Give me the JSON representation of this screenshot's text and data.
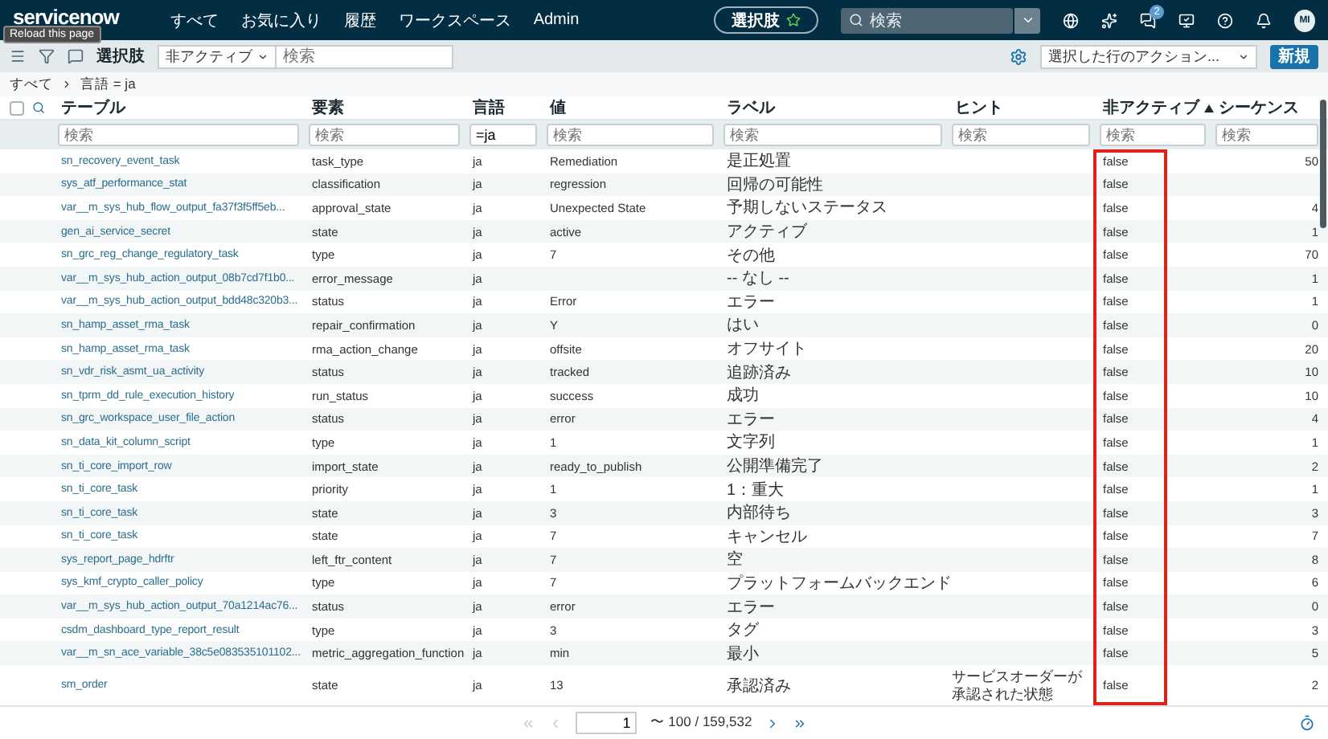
{
  "nav": {
    "logo": "servicenow",
    "items": [
      "すべて",
      "お気に入り",
      "履歴",
      "ワークスペース",
      "Admin"
    ],
    "context": "選択肢",
    "search": {
      "placeholder": "検索"
    },
    "icons": [
      {
        "kind": "globe"
      },
      {
        "kind": "sparkle"
      },
      {
        "kind": "chat",
        "badge": "2"
      },
      {
        "kind": "screen"
      },
      {
        "kind": "help"
      },
      {
        "kind": "bell"
      }
    ],
    "avatar": "MI"
  },
  "tooltip": "Reload this page",
  "toolbar": {
    "title": "選択肢",
    "field_select": "非アクティブ",
    "search": {
      "placeholder": "検索"
    },
    "actions_select": "選択した行のアクション...",
    "new_button": "新規"
  },
  "breadcrumb": [
    "すべて",
    "言語 = ja"
  ],
  "table": {
    "select_all": {
      "checked": false
    },
    "columns": [
      {
        "label": "テーブル",
        "filter": {
          "placeholder": "検索"
        }
      },
      {
        "label": "要素",
        "filter": {
          "placeholder": "検索"
        }
      },
      {
        "label": "言語",
        "filter": {
          "value": "=ja"
        }
      },
      {
        "label": "値",
        "filter": {
          "placeholder": "検索"
        }
      },
      {
        "label": "ラベル",
        "filter": {
          "placeholder": "検索"
        }
      },
      {
        "label": "ヒント",
        "filter": {
          "placeholder": "検索"
        }
      },
      {
        "label": "非アクティブ",
        "sort_ascending": true,
        "filter": {
          "placeholder": "検索"
        }
      },
      {
        "label": "シーケンス",
        "filter": {
          "placeholder": "検索"
        }
      }
    ],
    "rows": [
      {
        "table": "sn_recovery_event_task",
        "element": "task_type",
        "language": "ja",
        "value": "Remediation",
        "label": "是正処置",
        "inactive": "false",
        "sequence": "50"
      },
      {
        "table": "sys_atf_performance_stat",
        "element": "classification",
        "language": "ja",
        "value": "regression",
        "label": "回帰の可能性",
        "inactive": "false"
      },
      {
        "table": "var__m_sys_hub_flow_output_fa37f3f5ff5eb...",
        "element": "approval_state",
        "language": "ja",
        "value": "Unexpected State",
        "label": "予期しないステータス",
        "inactive": "false",
        "sequence": "4"
      },
      {
        "table": "gen_ai_service_secret",
        "element": "state",
        "language": "ja",
        "value": "active",
        "label": "アクティブ",
        "inactive": "false",
        "sequence": "1"
      },
      {
        "table": "sn_grc_reg_change_regulatory_task",
        "element": "type",
        "language": "ja",
        "value": "7",
        "label": "その他",
        "inactive": "false",
        "sequence": "70"
      },
      {
        "table": "var__m_sys_hub_action_output_08b7cd7f1b0...",
        "element": "error_message",
        "language": "ja",
        "label": "-- なし --",
        "inactive": "false",
        "sequence": "1"
      },
      {
        "table": "var__m_sys_hub_action_output_bdd48c320b3...",
        "element": "status",
        "language": "ja",
        "value": "Error",
        "label": "エラー",
        "inactive": "false",
        "sequence": "1"
      },
      {
        "table": "sn_hamp_asset_rma_task",
        "element": "repair_confirmation",
        "language": "ja",
        "value": "Y",
        "label": "はい",
        "inactive": "false",
        "sequence": "0"
      },
      {
        "table": "sn_hamp_asset_rma_task",
        "element": "rma_action_change",
        "language": "ja",
        "value": "offsite",
        "label": "オフサイト",
        "inactive": "false",
        "sequence": "20"
      },
      {
        "table": "sn_vdr_risk_asmt_ua_activity",
        "element": "status",
        "language": "ja",
        "value": "tracked",
        "label": "追跡済み",
        "inactive": "false",
        "sequence": "10"
      },
      {
        "table": "sn_tprm_dd_rule_execution_history",
        "element": "run_status",
        "language": "ja",
        "value": "success",
        "label": "成功",
        "inactive": "false",
        "sequence": "10"
      },
      {
        "table": "sn_grc_workspace_user_file_action",
        "element": "status",
        "language": "ja",
        "value": "error",
        "label": "エラー",
        "inactive": "false",
        "sequence": "4"
      },
      {
        "table": "sn_data_kit_column_script",
        "element": "type",
        "language": "ja",
        "value": "1",
        "label": "文字列",
        "inactive": "false",
        "sequence": "1"
      },
      {
        "table": "sn_ti_core_import_row",
        "element": "import_state",
        "language": "ja",
        "value": "ready_to_publish",
        "label": "公開準備完了",
        "inactive": "false",
        "sequence": "2"
      },
      {
        "table": "sn_ti_core_task",
        "element": "priority",
        "language": "ja",
        "value": "1",
        "label": "1：重大",
        "inactive": "false",
        "sequence": "1"
      },
      {
        "table": "sn_ti_core_task",
        "element": "state",
        "language": "ja",
        "value": "3",
        "label": "内部待ち",
        "inactive": "false",
        "sequence": "3"
      },
      {
        "table": "sn_ti_core_task",
        "element": "state",
        "language": "ja",
        "value": "7",
        "label": "キャンセル",
        "inactive": "false",
        "sequence": "7"
      },
      {
        "table": "sys_report_page_hdrftr",
        "element": "left_ftr_content",
        "language": "ja",
        "value": "7",
        "label": "空",
        "inactive": "false",
        "sequence": "8"
      },
      {
        "table": "sys_kmf_crypto_caller_policy",
        "element": "type",
        "language": "ja",
        "value": "7",
        "label": "プラットフォームバックエンド",
        "inactive": "false",
        "sequence": "6"
      },
      {
        "table": "var__m_sys_hub_action_output_70a1214ac76...",
        "element": "status",
        "language": "ja",
        "value": "error",
        "label": "エラー",
        "inactive": "false",
        "sequence": "0"
      },
      {
        "table": "csdm_dashboard_type_report_result",
        "element": "type",
        "language": "ja",
        "value": "3",
        "label": "タグ",
        "inactive": "false",
        "sequence": "3"
      },
      {
        "table": "var__m_sn_ace_variable_38c5e083535101102...",
        "element": "metric_aggregation_function",
        "language": "ja",
        "value": "min",
        "label": "最小",
        "inactive": "false",
        "sequence": "5"
      },
      {
        "table": "sm_order",
        "element": "state",
        "language": "ja",
        "value": "13",
        "label": "承認済み",
        "hint": "サービスオーダーが承認された状態",
        "inactive": "false",
        "sequence": "2"
      }
    ]
  },
  "pager": {
    "page": "1",
    "range": "〜 100 / 159,532",
    "buttons": [
      {
        "kind": "first",
        "disabled": true
      },
      {
        "kind": "prev",
        "disabled": true
      },
      {
        "kind": "next",
        "disabled": false
      },
      {
        "kind": "last",
        "disabled": false
      }
    ]
  }
}
